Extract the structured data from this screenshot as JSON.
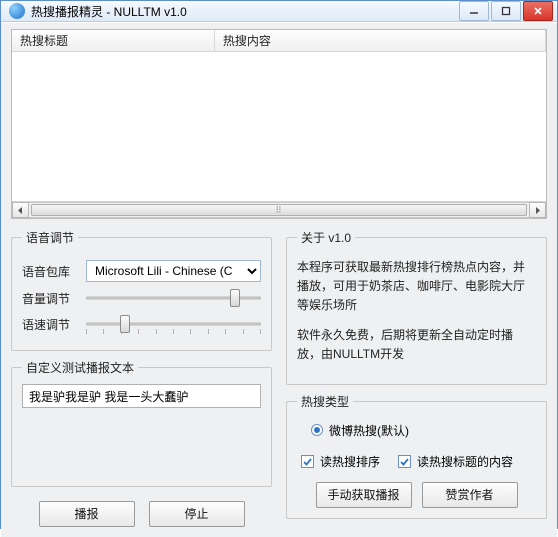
{
  "window": {
    "title": "热搜播报精灵 - NULLTM v1.0"
  },
  "listview": {
    "columns": [
      "热搜标题",
      "热搜内容"
    ]
  },
  "voice": {
    "legend": "语音调节",
    "voice_pack_label": "语音包库",
    "voice_pack_value": "Microsoft Lili - Chinese (C",
    "volume_label": "音量调节",
    "rate_label": "语速调节",
    "volume_value_pct": 85,
    "rate_value_pct": 22
  },
  "custom_text": {
    "legend": "自定义测试播报文本",
    "value": "我是驴我是驴 我是一头大蠢驴"
  },
  "left_buttons": {
    "broadcast": "播报",
    "stop": "停止"
  },
  "about": {
    "legend": "关于 v1.0",
    "p1": "本程序可获取最新热搜排行榜热点内容，并播放，可用于奶茶店、咖啡厅、电影院大厅等娱乐场所",
    "p2": "软件永久免费，后期将更新全自动定时播放，由NULLTM开发"
  },
  "hot_type": {
    "legend": "热搜类型",
    "radio_label": "微博热搜(默认)",
    "check1": "读热搜排序",
    "check2": "读热搜标题的内容",
    "btn_manual": "手动获取播报",
    "btn_praise": "赞赏作者"
  }
}
